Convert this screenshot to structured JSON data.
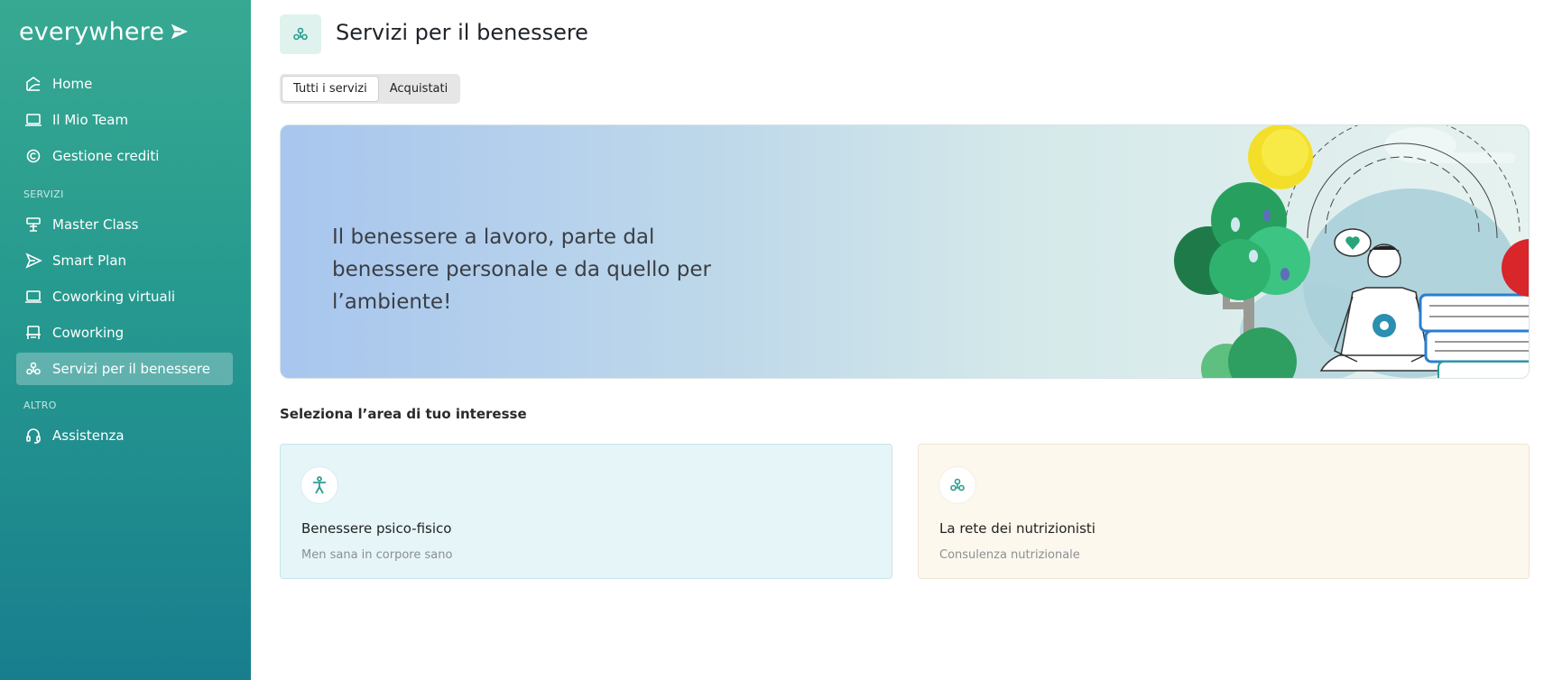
{
  "brand": {
    "name": "everywhere"
  },
  "sidebar": {
    "items": [
      {
        "label": "Home",
        "icon": "home-icon"
      },
      {
        "label": "Il Mio Team",
        "icon": "laptop-icon"
      },
      {
        "label": "Gestione crediti",
        "icon": "copyright-icon"
      }
    ],
    "section_services": "SERVIZI",
    "services": [
      {
        "label": "Master Class",
        "icon": "presentation-icon"
      },
      {
        "label": "Smart Plan",
        "icon": "paper-plane-icon"
      },
      {
        "label": "Coworking virtuali",
        "icon": "laptop-icon"
      },
      {
        "label": "Coworking",
        "icon": "desk-icon"
      },
      {
        "label": "Servizi per il benessere",
        "icon": "lotus-icon",
        "active": true
      }
    ],
    "section_other": "ALTRO",
    "other": [
      {
        "label": "Assistenza",
        "icon": "headset-icon"
      }
    ]
  },
  "header": {
    "title": "Servizi per il benessere",
    "icon": "lotus-icon"
  },
  "tabs": [
    {
      "label": "Tutti i servizi",
      "active": true
    },
    {
      "label": "Acquistati",
      "active": false
    }
  ],
  "banner": {
    "text": "Il benessere a lavoro, parte dal benessere personale e da quello per l’ambiente!"
  },
  "section_title": "Seleziona l’area di tuo interesse",
  "cards": [
    {
      "title": "Benessere psico-fisico",
      "subtitle": "Men sana in corpore sano",
      "icon": "person-icon"
    },
    {
      "title": "La rete dei nutrizionisti",
      "subtitle": "Consulenza nutrizionale",
      "icon": "lotus-icon"
    }
  ],
  "colors": {
    "sidebar_top": "#37a992",
    "sidebar_bottom": "#187e8e",
    "accent": "#2a9d8f"
  }
}
